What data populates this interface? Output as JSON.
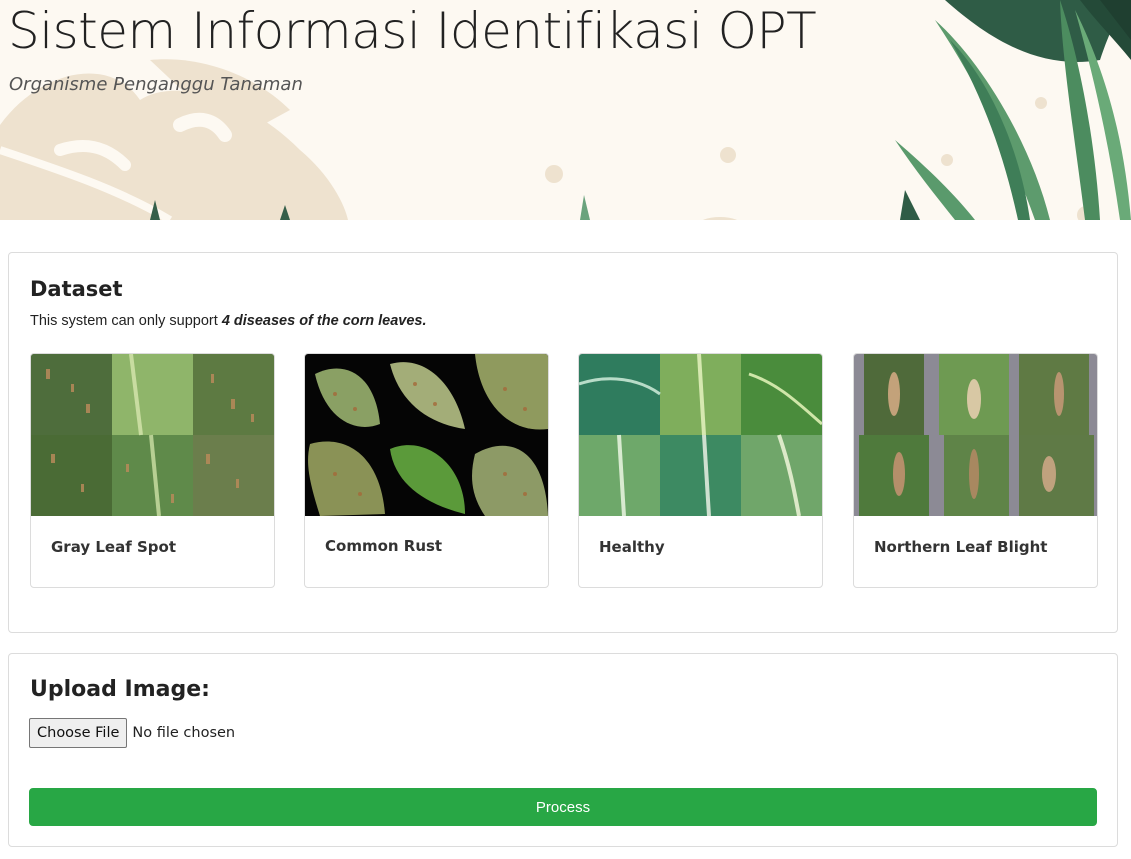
{
  "hero": {
    "title": "Sistem Informasi Identifikasi OPT",
    "subtitle": "Organisme Penganggu Tanaman"
  },
  "dataset": {
    "heading": "Dataset",
    "description_prefix": "This system can only support ",
    "description_emphasis": "4 diseases of the corn leaves.",
    "cards": [
      {
        "label": "Gray Leaf Spot"
      },
      {
        "label": "Common Rust"
      },
      {
        "label": "Healthy"
      },
      {
        "label": "Northern Leaf Blight"
      }
    ]
  },
  "upload": {
    "heading": "Upload Image:",
    "choose_file_label": "Choose File",
    "no_file_text": "No file chosen",
    "process_label": "Process"
  },
  "colors": {
    "hero_background": "#fdf9f2",
    "hero_shape": "#eee2cf",
    "leaf_green": "#4a8a5c",
    "process_button": "#28a745"
  }
}
